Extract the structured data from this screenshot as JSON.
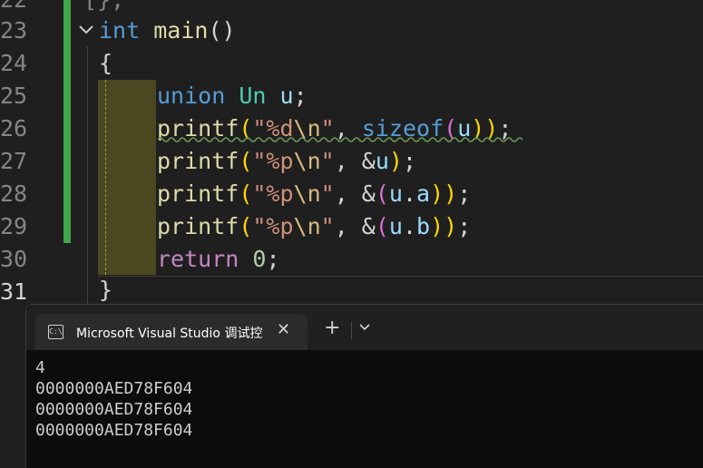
{
  "editor": {
    "line_numbers": [
      "22",
      "23",
      "24",
      "25",
      "26",
      "27",
      "28",
      "29",
      "30",
      "31"
    ],
    "code": {
      "l22": "[};",
      "l23_kw": "int",
      "l23_fn": "main",
      "l23_parens": "()",
      "l24": "{",
      "l25": {
        "kw": "union",
        "type": "Un",
        "var": "u",
        "end": ";"
      },
      "l26": {
        "fn": "printf",
        "open": "(",
        "q1": "\"%d",
        "esc": "\\n",
        "q2": "\"",
        "comma": ", ",
        "kw": "sizeof",
        "open2": "(",
        "var": "u",
        "close": "))",
        "end": ";"
      },
      "l27": {
        "fn": "printf",
        "open": "(",
        "q1": "\"%p",
        "esc": "\\n",
        "q2": "\"",
        "rest": ", &",
        "var": "u",
        "close": ")",
        "end": ";"
      },
      "l28": {
        "fn": "printf",
        "open": "(",
        "q1": "\"%p",
        "esc": "\\n",
        "q2": "\"",
        "rest": ", &",
        "open2": "(",
        "var": "u",
        "dot": ".",
        "member": "a",
        "close": "))",
        "end": ";"
      },
      "l29": {
        "fn": "printf",
        "open": "(",
        "q1": "\"%p",
        "esc": "\\n",
        "q2": "\"",
        "rest": ", &",
        "open2": "(",
        "var": "u",
        "dot": ".",
        "member": "b",
        "close": "))",
        "end": ";"
      },
      "l30": {
        "kw": "return",
        "num": "0",
        "end": ";"
      },
      "l31": "}"
    }
  },
  "console": {
    "tab_icon": "C:\\",
    "tab_title": "Microsoft Visual Studio 调试控",
    "close_icon": "✕",
    "new_tab_icon": "+",
    "dropdown_icon": "⌄",
    "output": [
      "4",
      "0000000AED78F604",
      "0000000AED78F604",
      "0000000AED78F604"
    ]
  },
  "colors": {
    "keyword": "#569cd6",
    "control_keyword": "#c586c0",
    "function": "#dcdcaa",
    "type": "#4ec9b0",
    "variable": "#9cdcfe",
    "string": "#ce9178",
    "git_added": "#3ea84a",
    "squiggle": "#6a9955"
  }
}
